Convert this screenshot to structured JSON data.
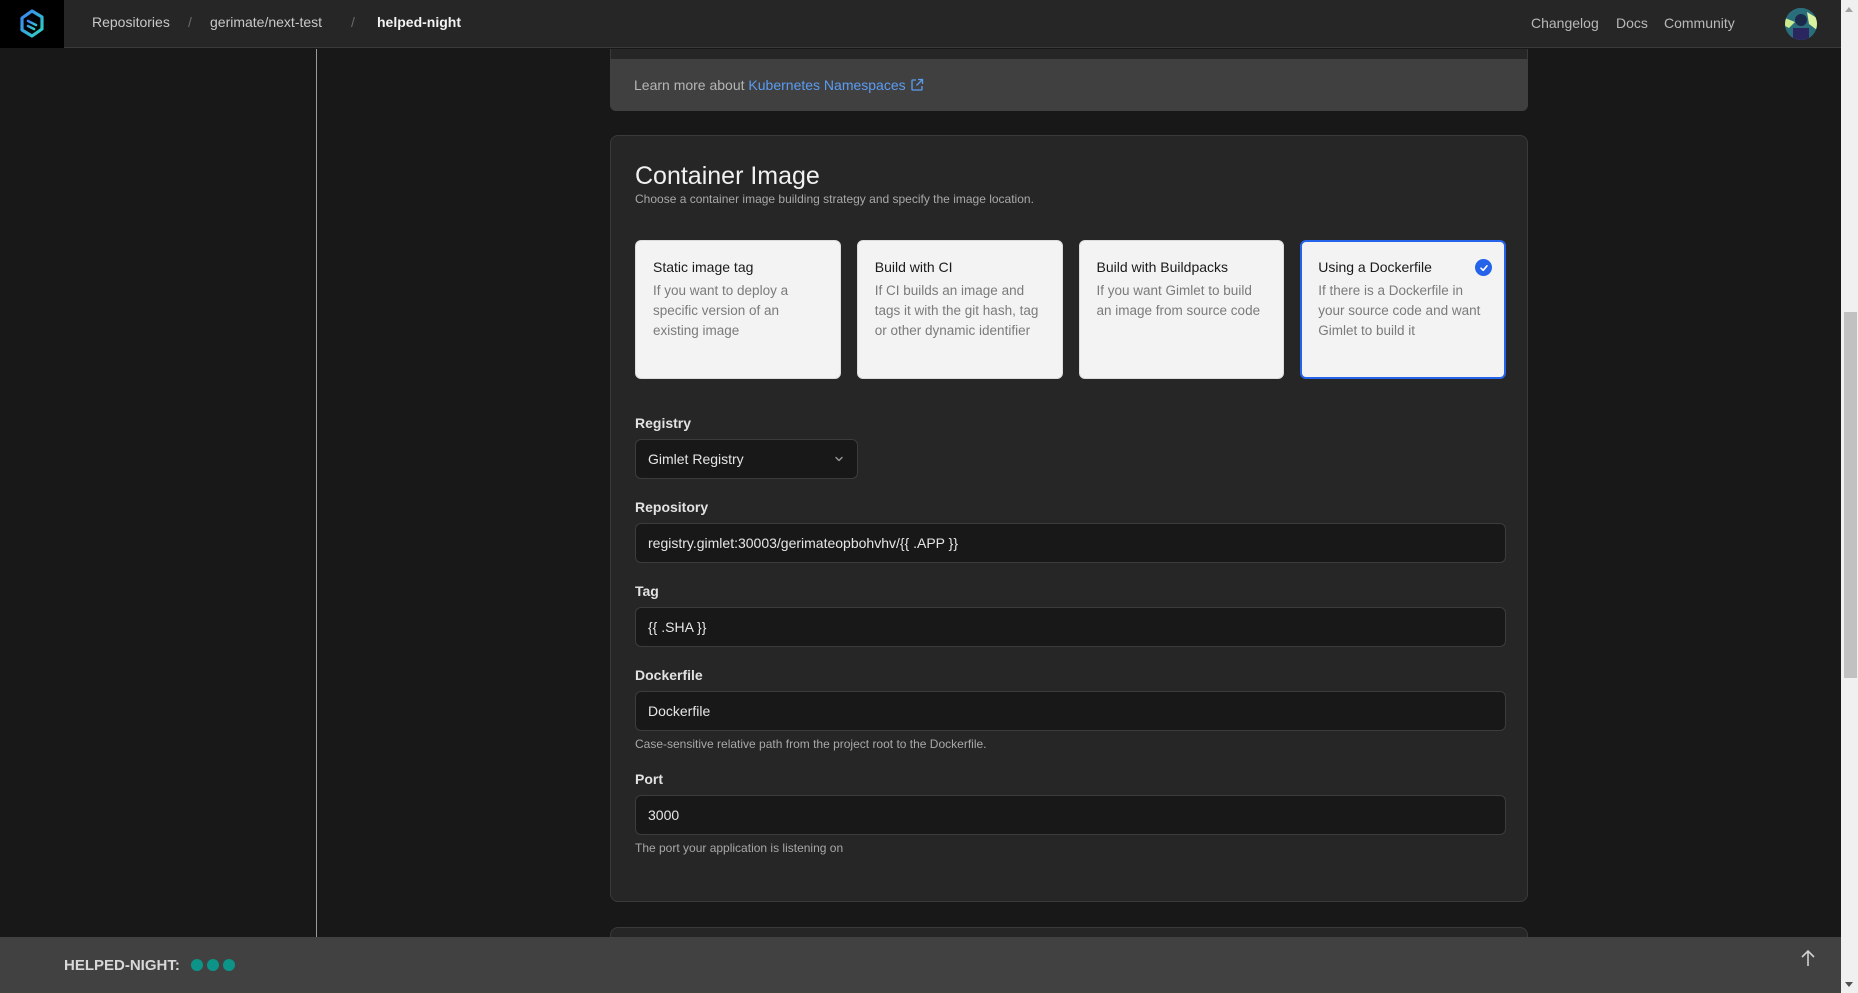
{
  "header": {
    "breadcrumbs": [
      {
        "label": "Repositories"
      },
      {
        "label": "gerimate/next-test"
      },
      {
        "label": "helped-night"
      }
    ],
    "separator": "/",
    "nav": [
      {
        "label": "Changelog"
      },
      {
        "label": "Docs"
      },
      {
        "label": "Community"
      }
    ],
    "logo_icon": "gimlet-logo-icon",
    "avatar_icon": "user-avatar"
  },
  "namespace_section": {
    "learn_more_prefix": "Learn more about",
    "learn_more_link": "Kubernetes Namespaces",
    "link_icon": "external-link-icon"
  },
  "container_image": {
    "title": "Container Image",
    "subtitle": "Choose a container image building strategy and specify the image location.",
    "options": [
      {
        "title": "Static image tag",
        "description": "If you want to deploy a specific version of an existing image",
        "selected": false
      },
      {
        "title": "Build with CI",
        "description": "If CI builds an image and tags it with the git hash, tag or other dynamic identifier",
        "selected": false
      },
      {
        "title": "Build with Buildpacks",
        "description": "If you want Gimlet to build an image from source code",
        "selected": false
      },
      {
        "title": "Using a Dockerfile",
        "description": "If there is a Dockerfile in your source code and want Gimlet to build it",
        "selected": true
      }
    ],
    "registry": {
      "label": "Registry",
      "value": "Gimlet Registry"
    },
    "repository": {
      "label": "Repository",
      "value": "registry.gimlet:30003/gerimateopbohvhv/{{ .APP }}"
    },
    "tag": {
      "label": "Tag",
      "value": "{{ .SHA }}"
    },
    "dockerfile": {
      "label": "Dockerfile",
      "value": "Dockerfile",
      "help": "Case-sensitive relative path from the project root to the Dockerfile."
    },
    "port": {
      "label": "Port",
      "value": "3000",
      "help": "The port your application is listening on"
    }
  },
  "footer": {
    "env_label": "HELPED-NIGHT:",
    "status_dots": 3,
    "status_color": "#0d9488",
    "scroll_top_icon": "arrow-up-icon"
  },
  "colors": {
    "accent": "#2563eb",
    "link": "#5b9cf2"
  }
}
